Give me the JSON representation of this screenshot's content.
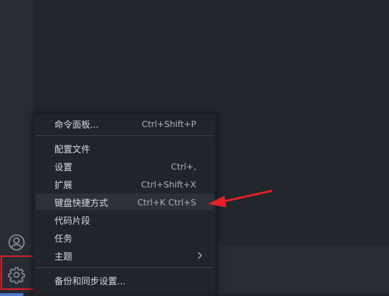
{
  "icons": {
    "accounts": "account-icon",
    "manage": "gear-icon",
    "submenu": "chevron-right-icon"
  },
  "colors": {
    "annotation": "#e5202a",
    "menu_bg": "#21252b",
    "menu_active": "#2c313a"
  },
  "menu": {
    "items": [
      {
        "label": "命令面板...",
        "shortcut": "Ctrl+Shift+P"
      },
      {
        "label": "配置文件",
        "shortcut": ""
      },
      {
        "label": "设置",
        "shortcut": "Ctrl+,"
      },
      {
        "label": "扩展",
        "shortcut": "Ctrl+Shift+X"
      },
      {
        "label": "键盘快捷方式",
        "shortcut": "Ctrl+K Ctrl+S"
      },
      {
        "label": "代码片段",
        "shortcut": ""
      },
      {
        "label": "任务",
        "shortcut": ""
      },
      {
        "label": "主题",
        "shortcut": ""
      },
      {
        "label": "备份和同步设置...",
        "shortcut": ""
      }
    ],
    "active_item": "键盘快捷方式"
  }
}
